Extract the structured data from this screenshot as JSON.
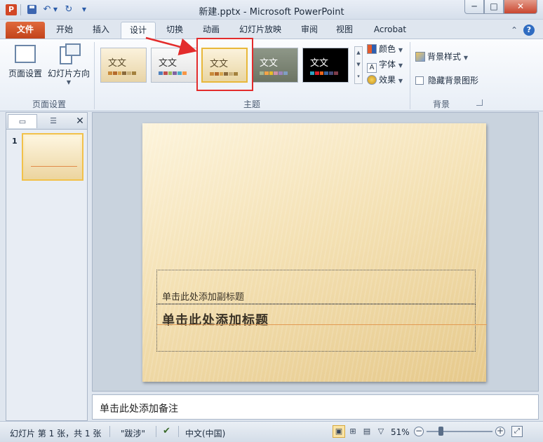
{
  "window": {
    "title": "新建.pptx - Microsoft PowerPoint",
    "app_icon": "P",
    "minimize": "─",
    "maximize": "□",
    "close": "✕"
  },
  "quick_access": {
    "undo_icon": "↶",
    "redo_icon": "↻",
    "dropdown": "▼"
  },
  "tabs": [
    "文件",
    "开始",
    "插入",
    "设计",
    "切换",
    "动画",
    "幻灯片放映",
    "审阅",
    "视图",
    "Acrobat"
  ],
  "active_tab": "设计",
  "ribbon": {
    "page_setup": {
      "page_setup_label": "页面设置",
      "orientation_label": "幻灯片方向",
      "group_label": "页面设置"
    },
    "themes": {
      "group_label": "主题",
      "items": [
        {
          "sample": "文文",
          "bg": "#f6e7c3",
          "fg": "#5a4a2a"
        },
        {
          "sample": "文文",
          "bg": "#f1f1f1",
          "fg": "#333333"
        },
        {
          "sample": "文文",
          "bg": "#f6e7c3",
          "fg": "#5a4a2a"
        },
        {
          "sample": "文文",
          "bg": "#7c8574",
          "fg": "#ffffff"
        },
        {
          "sample": "文文",
          "bg": "#000000",
          "fg": "#ffffff"
        }
      ],
      "colors_label": "颜色",
      "fonts_label": "字体",
      "effects_label": "效果"
    },
    "background": {
      "style_label": "背景样式",
      "hide_label": "隐藏背景图形",
      "group_label": "背景"
    }
  },
  "slide_pane": {
    "slide_number": "1"
  },
  "slide": {
    "subtitle_placeholder": "单击此处添加副标题",
    "title_placeholder": "单击此处添加标题"
  },
  "notes": {
    "placeholder": "单击此处添加备注"
  },
  "status": {
    "slide_info": "幻灯片 第 1 张，共 1 张",
    "theme_name": "\"跋涉\"",
    "language": "中文(中国)",
    "zoom": "51%"
  },
  "colors": {
    "file_tab": "#d0542a",
    "annotation": "#e32c2c",
    "selected_theme_border": "#e8b83a"
  }
}
